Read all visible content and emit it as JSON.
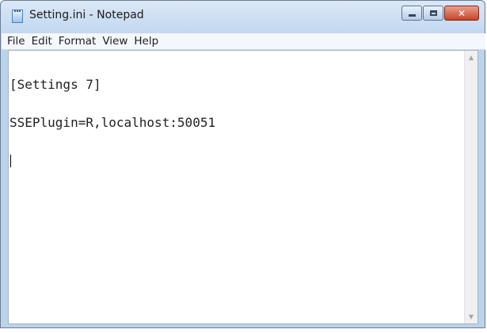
{
  "window": {
    "title": "Setting.ini - Notepad",
    "icon": "notepad-icon"
  },
  "caption_buttons": {
    "minimize_icon": "minimize-icon",
    "maximize_icon": "maximize-icon",
    "close_icon": "close-icon",
    "close_glyph": "✕"
  },
  "menu": {
    "items": [
      {
        "label": "File"
      },
      {
        "label": "Edit"
      },
      {
        "label": "Format"
      },
      {
        "label": "View"
      },
      {
        "label": "Help"
      }
    ]
  },
  "editor": {
    "lines": [
      "[Settings 7]",
      "SSEPlugin=R,localhost:50051"
    ]
  },
  "scrollbar": {
    "up_glyph": "▲",
    "down_glyph": "▼"
  }
}
